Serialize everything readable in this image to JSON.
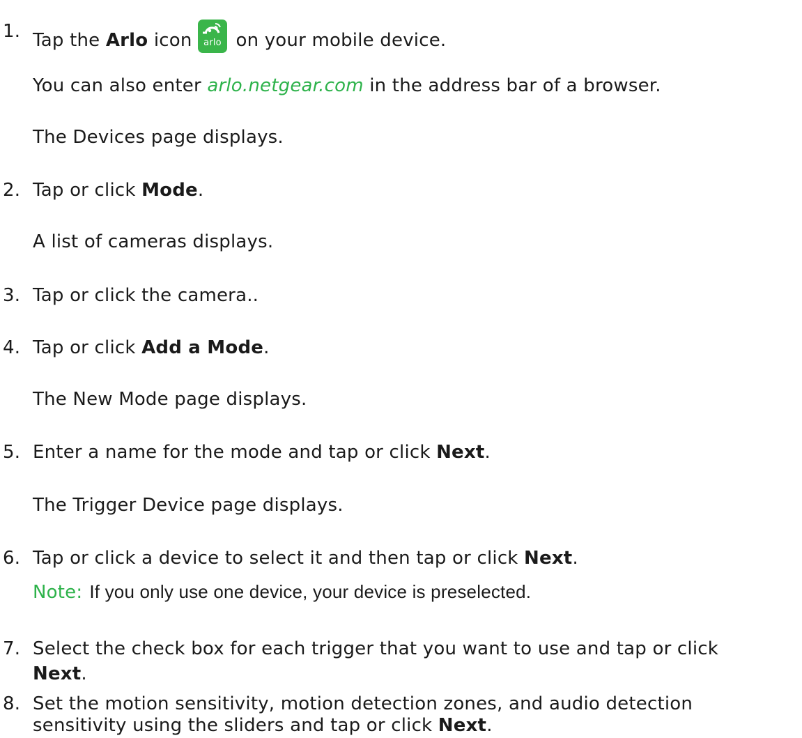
{
  "brand_color": "#2db24a",
  "icon": {
    "name": "arlo-app-icon",
    "word": "arlo"
  },
  "steps": [
    {
      "number": "1.",
      "pre": "Tap the ",
      "bold": "Arlo",
      "post_icon_pre": " icon",
      "post": " on your mobile device.",
      "paras": [
        {
          "pre": "You can also enter ",
          "link": "arlo.netgear.com",
          "post": " in the address bar of a browser."
        },
        {
          "text": "The Devices page displays."
        }
      ]
    },
    {
      "number": "2.",
      "pre": "Tap or click ",
      "bold": "Mode",
      "post": ".",
      "paras": [
        {
          "text": "A list of cameras displays."
        }
      ]
    },
    {
      "number": "3.",
      "text": "Tap or click the camera.."
    },
    {
      "number": "4.",
      "pre": "Tap or click ",
      "bold": "Add a Mode",
      "post": ".",
      "paras": [
        {
          "text": "The New Mode page displays."
        }
      ]
    },
    {
      "number": "5.",
      "pre": "Enter a name for the mode and tap or click ",
      "bold": "Next",
      "post": ".",
      "paras": [
        {
          "text": "The Trigger Device page displays."
        }
      ]
    },
    {
      "number": "6.",
      "pre": "Tap or click a device to select it and then tap or click ",
      "bold": "Next",
      "post": ".",
      "note": {
        "label": "Note:",
        "text": "If you only use one device, your device is preselected."
      }
    },
    {
      "number": "7.",
      "pre": "Select the check box for each trigger that you want to use and tap or click",
      "bold": "Next",
      "post": "."
    },
    {
      "number": "8.",
      "pre": "Set the motion sensitivity, motion detection zones, and audio detection",
      "pre2": "sensitivity using the sliders and tap or click ",
      "bold": "Next",
      "post": "."
    }
  ]
}
